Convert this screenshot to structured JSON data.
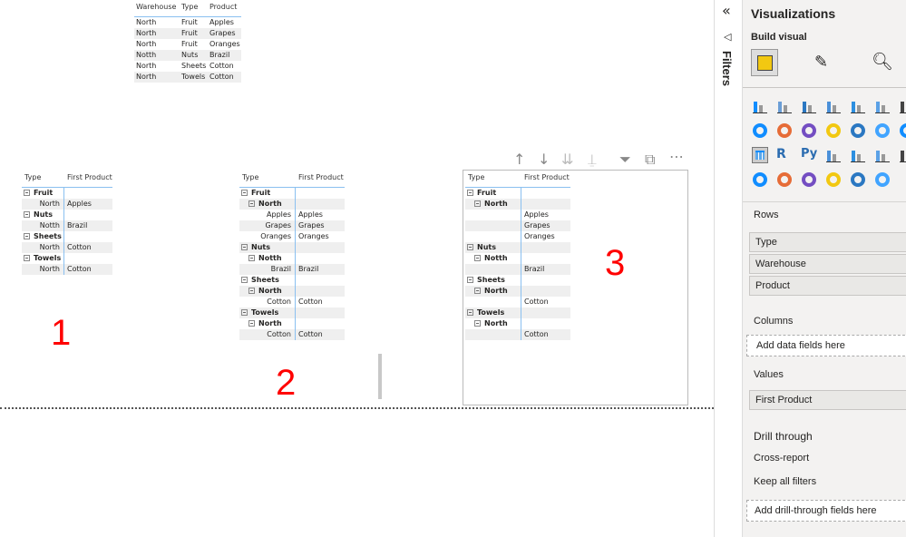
{
  "source_table": {
    "headers": [
      "Warehouse",
      "Type",
      "Product"
    ],
    "rows": [
      [
        "North",
        "Fruit",
        "Apples"
      ],
      [
        "North",
        "Fruit",
        "Grapes"
      ],
      [
        "North",
        "Fruit",
        "Oranges"
      ],
      [
        "Notth",
        "Nuts",
        "Brazil"
      ],
      [
        "North",
        "Sheets",
        "Cotton"
      ],
      [
        "North",
        "Towels",
        "Cotton"
      ]
    ]
  },
  "matrix1": {
    "headers": [
      "Type",
      "First Product"
    ],
    "rows": [
      {
        "level": 0,
        "label": "Fruit",
        "value": ""
      },
      {
        "level": 1,
        "label": "North",
        "value": "Apples"
      },
      {
        "level": 0,
        "label": "Nuts",
        "value": ""
      },
      {
        "level": 1,
        "label": "Notth",
        "value": "Brazil"
      },
      {
        "level": 0,
        "label": "Sheets",
        "value": ""
      },
      {
        "level": 1,
        "label": "North",
        "value": "Cotton"
      },
      {
        "level": 0,
        "label": "Towels",
        "value": ""
      },
      {
        "level": 1,
        "label": "North",
        "value": "Cotton"
      }
    ]
  },
  "matrix2": {
    "headers": [
      "Type",
      "First Product"
    ],
    "rows": [
      {
        "level": 0,
        "label": "Fruit",
        "value": ""
      },
      {
        "level": 1,
        "label": "North",
        "value": ""
      },
      {
        "level": 2,
        "label": "Apples",
        "value": "Apples"
      },
      {
        "level": 2,
        "label": "Grapes",
        "value": "Grapes"
      },
      {
        "level": 2,
        "label": "Oranges",
        "value": "Oranges"
      },
      {
        "level": 0,
        "label": "Nuts",
        "value": ""
      },
      {
        "level": 1,
        "label": "Notth",
        "value": ""
      },
      {
        "level": 2,
        "label": "Brazil",
        "value": "Brazil"
      },
      {
        "level": 0,
        "label": "Sheets",
        "value": ""
      },
      {
        "level": 1,
        "label": "North",
        "value": ""
      },
      {
        "level": 2,
        "label": "Cotton",
        "value": "Cotton"
      },
      {
        "level": 0,
        "label": "Towels",
        "value": ""
      },
      {
        "level": 1,
        "label": "North",
        "value": ""
      },
      {
        "level": 2,
        "label": "Cotton",
        "value": "Cotton"
      }
    ]
  },
  "matrix3": {
    "headers": [
      "Type",
      "First Product"
    ],
    "rows": [
      {
        "level": 0,
        "label": "Fruit",
        "value": ""
      },
      {
        "level": 1,
        "label": "North",
        "value": ""
      },
      {
        "level": 2,
        "label": "",
        "value": "Apples"
      },
      {
        "level": 2,
        "label": "",
        "value": "Grapes"
      },
      {
        "level": 2,
        "label": "",
        "value": "Oranges"
      },
      {
        "level": 0,
        "label": "Nuts",
        "value": ""
      },
      {
        "level": 1,
        "label": "Notth",
        "value": ""
      },
      {
        "level": 2,
        "label": "",
        "value": "Brazil"
      },
      {
        "level": 0,
        "label": "Sheets",
        "value": ""
      },
      {
        "level": 1,
        "label": "North",
        "value": ""
      },
      {
        "level": 2,
        "label": "",
        "value": "Cotton"
      },
      {
        "level": 0,
        "label": "Towels",
        "value": ""
      },
      {
        "level": 1,
        "label": "North",
        "value": ""
      },
      {
        "level": 2,
        "label": "",
        "value": "Cotton"
      }
    ]
  },
  "annotations": [
    "1",
    "2",
    "3"
  ],
  "filters_label": "Filters",
  "pane": {
    "title": "Visualizations",
    "build_visual": "Build visual",
    "rows_label": "Rows",
    "rows_fields": [
      "Type",
      "Warehouse",
      "Product"
    ],
    "columns_label": "Columns",
    "columns_placeholder": "Add data fields here",
    "values_label": "Values",
    "values_fields": [
      "First Product"
    ],
    "drill_label": "Drill through",
    "cross_report": "Cross-report",
    "keep_filters": "Keep all filters",
    "drill_placeholder": "Add drill-through fields here",
    "viz_icons": [
      "stacked-bar",
      "stacked-column",
      "clustered-bar",
      "clustered-column",
      "100-bar",
      "100-column",
      "line",
      "scatter",
      "pie",
      "donut",
      "treemap",
      "map",
      "filled-map",
      "shape-map",
      "table",
      "r-visual",
      "python-visual",
      "key-influencers",
      "decomposition-tree",
      "qa",
      "smart-narrative",
      "funnel",
      "card",
      "multi-row-card",
      "gauge",
      "kpi",
      "paginated"
    ]
  },
  "colors": {
    "accent": "#118dff",
    "annotation": "#ff0000",
    "pane_bg": "#f3f2f1"
  }
}
